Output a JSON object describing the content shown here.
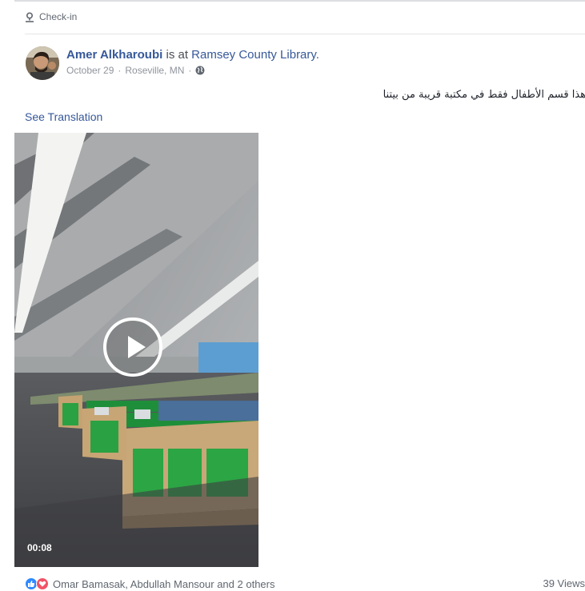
{
  "checkin": {
    "icon": "location-pin-icon",
    "label": "Check-in"
  },
  "post": {
    "author": "Amer Alkharoubi",
    "verb": "is at",
    "place": "Ramsey County Library.",
    "date": "October 29",
    "location": "Roseville, MN",
    "privacy_icon": "globe-icon",
    "text": "هذا قسم الأطفال فقط في مكتبة قريبة من بيتنا",
    "see_translation": "See Translation"
  },
  "video": {
    "duration": "00:08",
    "play_icon": "play-icon"
  },
  "footer": {
    "reaction_icons": [
      "like-icon",
      "love-icon"
    ],
    "reactors": "Omar Bamasak, Abdullah Mansour and 2 others",
    "views": "39 Views"
  },
  "colors": {
    "link": "#365899",
    "meta": "#90949c",
    "like": "#2e89ff",
    "love": "#f25268"
  }
}
